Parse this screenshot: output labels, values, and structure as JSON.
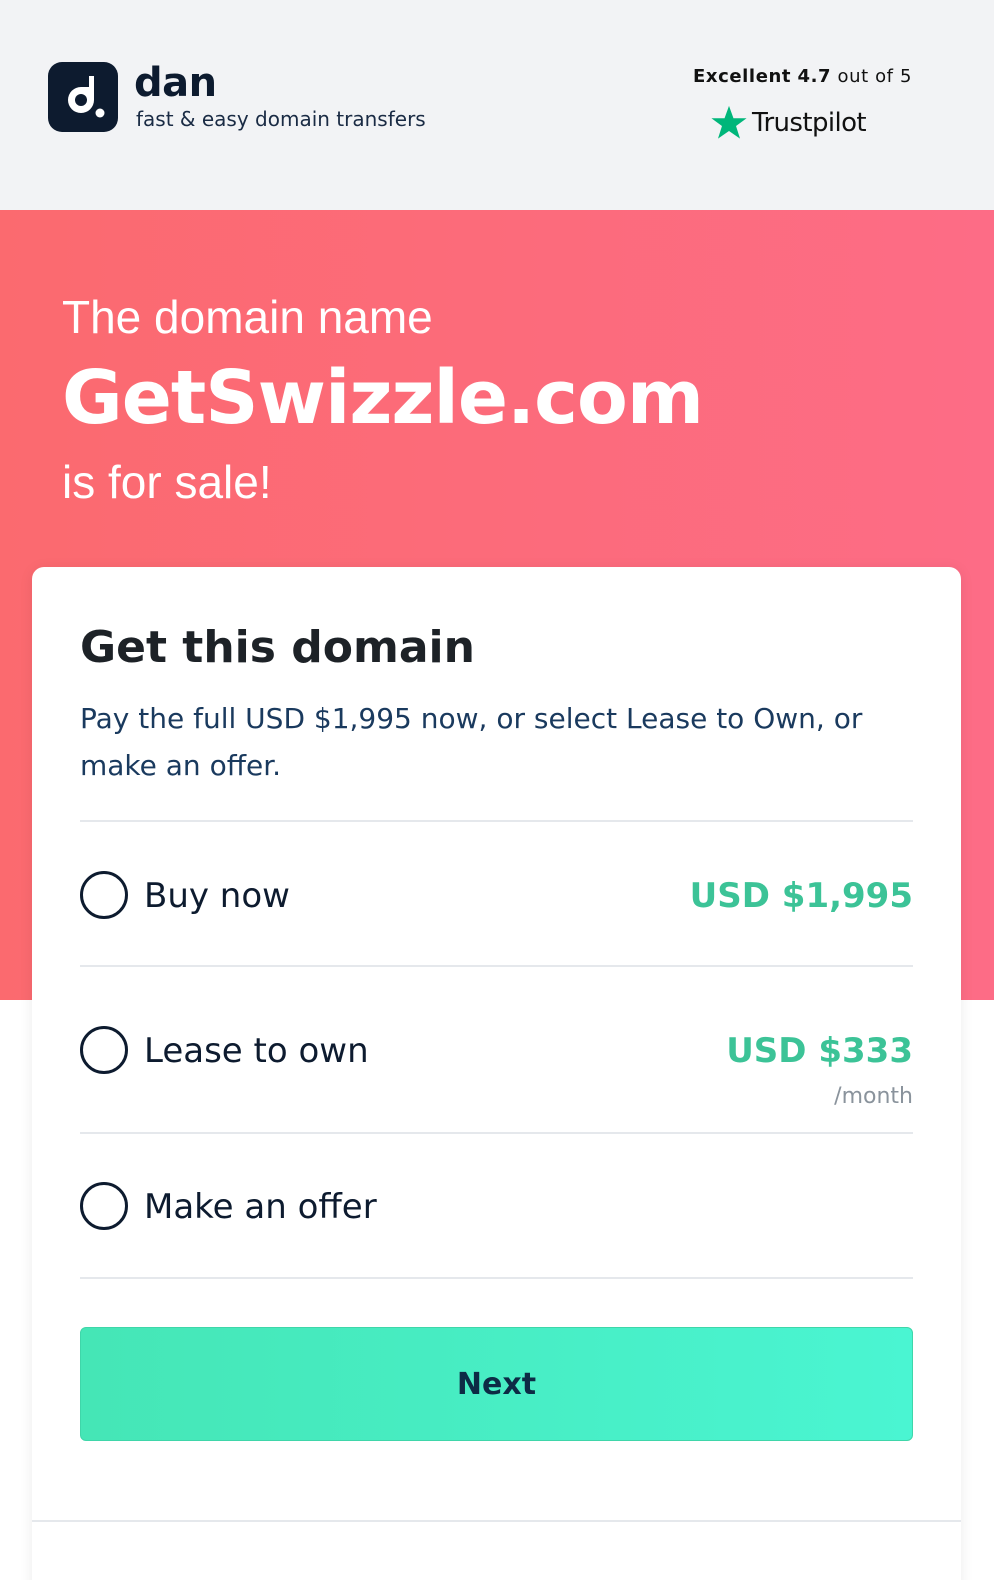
{
  "header": {
    "brand_name": "dan",
    "tagline": "fast & easy domain transfers",
    "rating_prefix": "Excellent",
    "rating_value": "4.7",
    "rating_suffix": "out of 5",
    "trustpilot_label": "Trustpilot"
  },
  "hero": {
    "line1": "The domain name",
    "domain": "GetSwizzle.com",
    "line3": "is for sale!"
  },
  "card": {
    "title": "Get this domain",
    "description": "Pay the full USD $1,995 now, or select Lease to Own, or make an offer.",
    "options": [
      {
        "label": "Buy now",
        "price": "USD $1,995",
        "sub": ""
      },
      {
        "label": "Lease to own",
        "price": "USD $333",
        "sub": "/month"
      },
      {
        "label": "Make an offer",
        "price": "",
        "sub": ""
      }
    ],
    "next_label": "Next"
  },
  "colors": {
    "brand_dark": "#0d1b2f",
    "hero_coral": "#fb6a6f",
    "hero_pink": "#fd6c86",
    "price_green": "#3cc397",
    "button_mint": "#45e6b6",
    "trustpilot_green": "#00b67a"
  },
  "icons": {
    "logo": "dan-logo-icon",
    "trustpilot_star": "trustpilot-star-icon",
    "radio": "radio-circle-icon"
  }
}
